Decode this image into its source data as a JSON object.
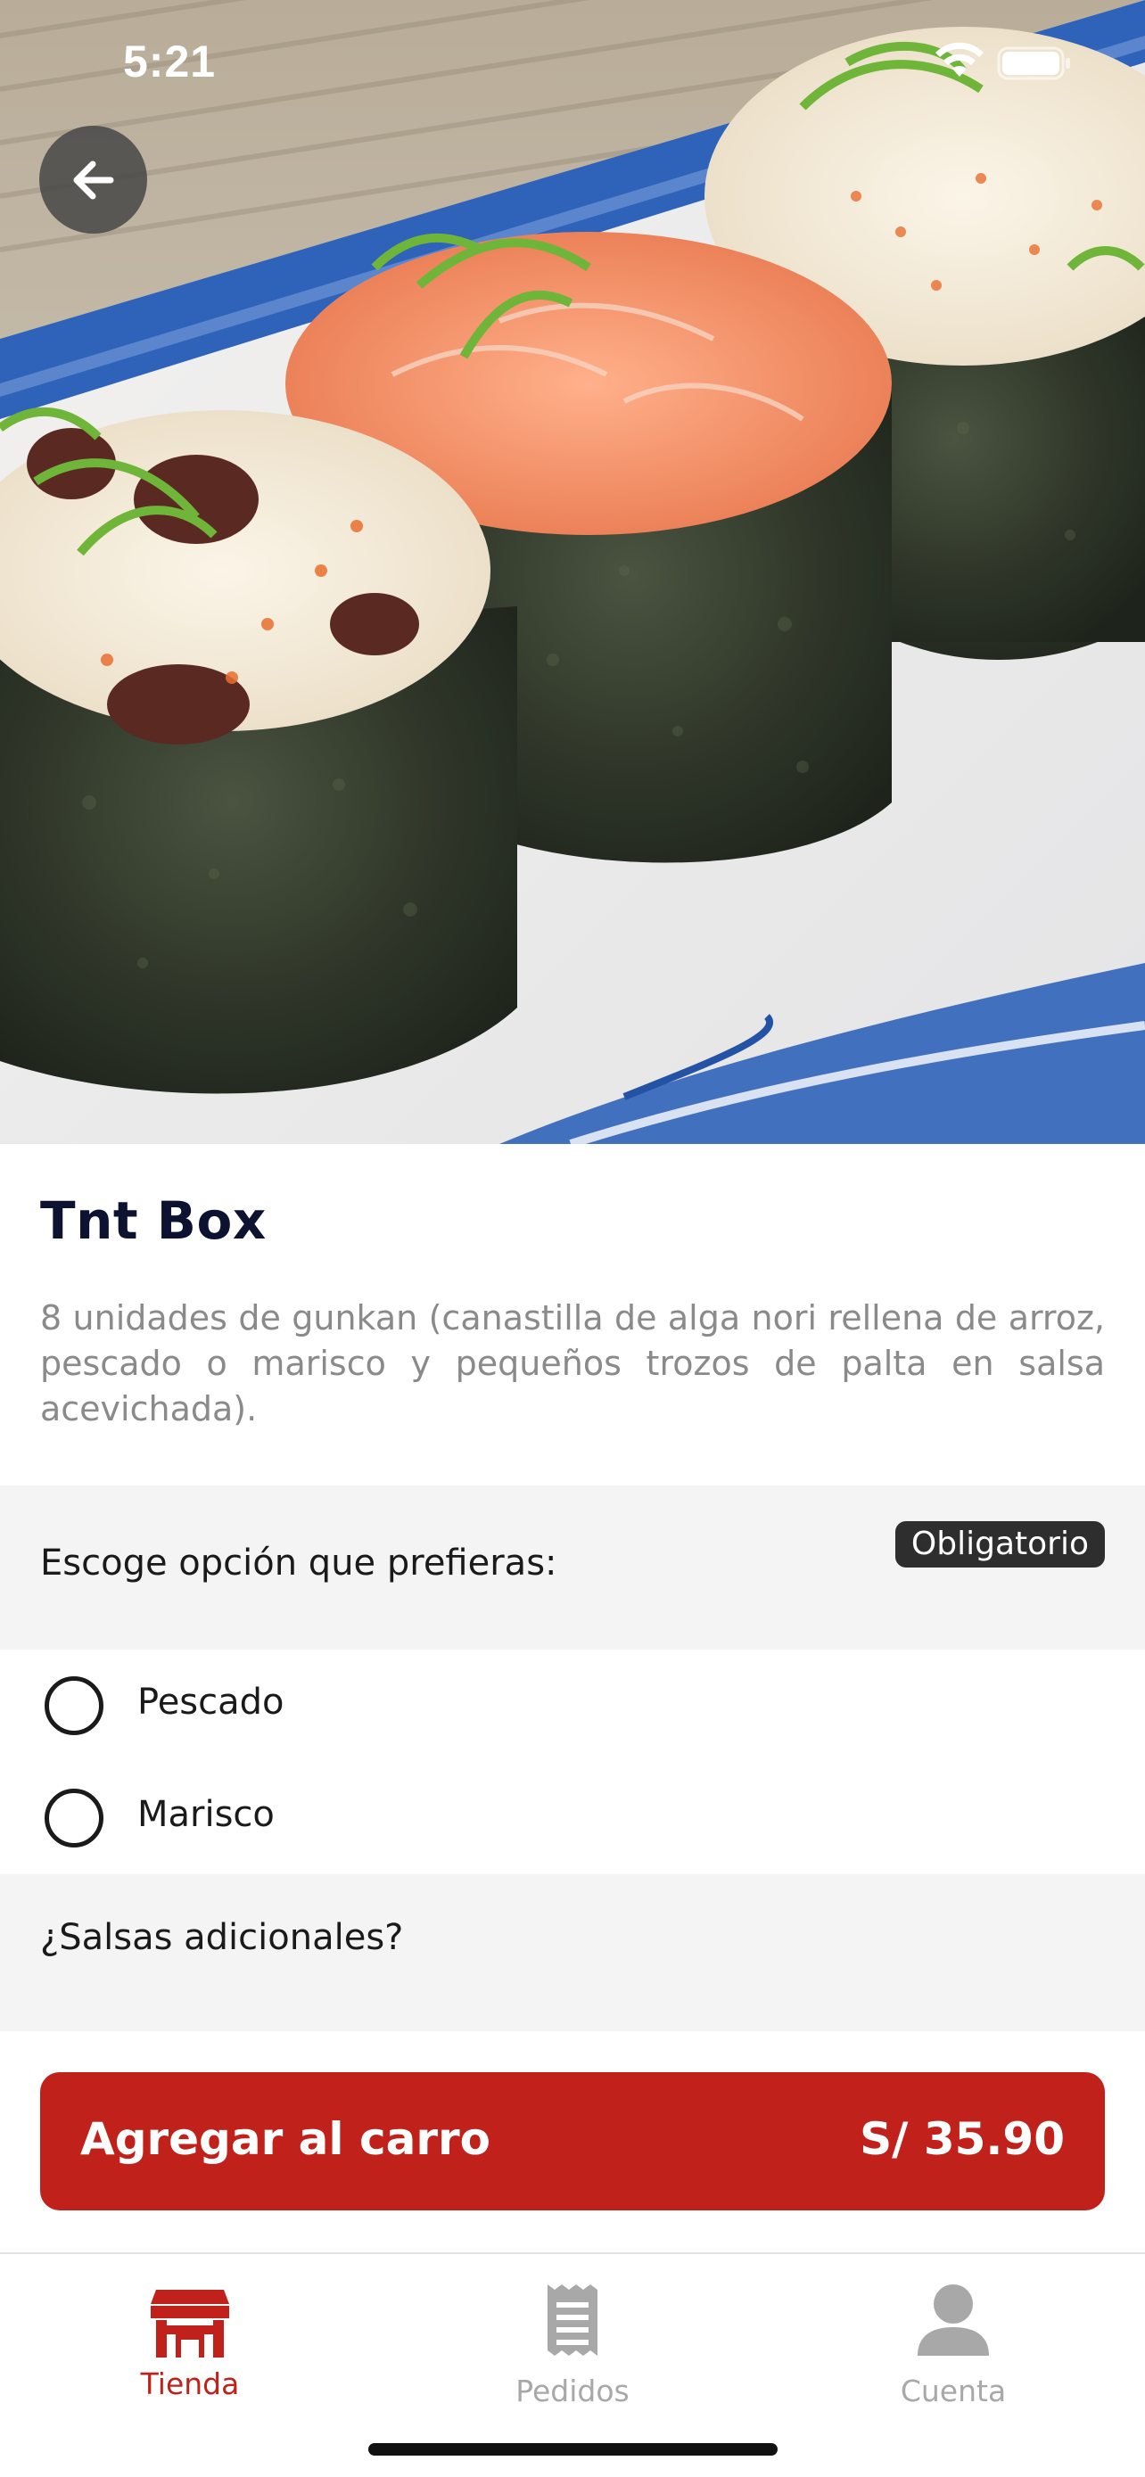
{
  "status_bar": {
    "time": "5:21",
    "icons": [
      "wifi-icon",
      "battery-icon"
    ]
  },
  "header": {
    "back_icon": "arrow-left-icon"
  },
  "product": {
    "title": "Tnt Box",
    "description": "8 unidades de gunkan (canastilla de alga nori rellena de arroz, pescado o marisco y pequeños trozos de palta en salsa acevichada)."
  },
  "option_group": {
    "label": "Escoge opción que prefieras:",
    "badge": "Obligatorio",
    "options": [
      {
        "label": "Pescado",
        "selected": false
      },
      {
        "label": "Marisco",
        "selected": false
      }
    ]
  },
  "extras_group": {
    "label": "¿Salsas adicionales?"
  },
  "cart_button": {
    "label": "Agregar al carro",
    "price": "S/ 35.90"
  },
  "tab_bar": {
    "tabs": [
      {
        "label": "Tienda",
        "icon": "store-icon",
        "active": true
      },
      {
        "label": "Pedidos",
        "icon": "receipt-icon",
        "active": false
      },
      {
        "label": "Cuenta",
        "icon": "user-icon",
        "active": false
      }
    ]
  },
  "colors": {
    "accent": "#c0221b",
    "title": "#0d1230",
    "inactive_tab": "#a8a8a8",
    "section_bg": "#f4f4f4"
  }
}
